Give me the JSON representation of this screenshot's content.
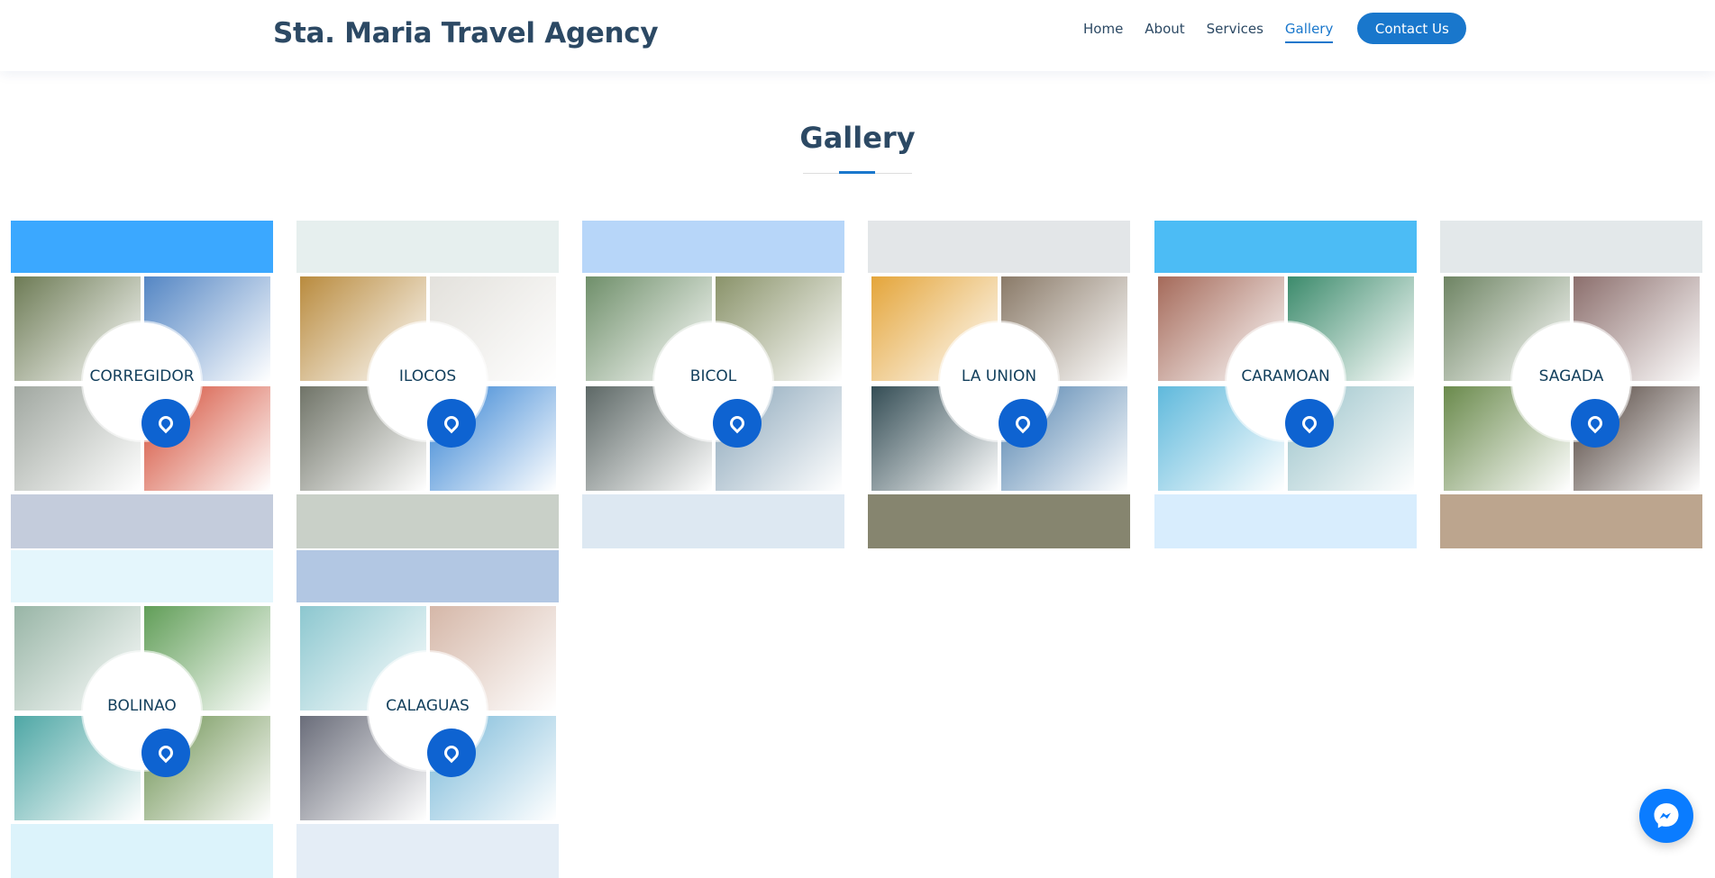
{
  "header": {
    "brand": "Sta. Maria Travel Agency",
    "nav": [
      "Home",
      "About",
      "Services",
      "Gallery"
    ],
    "active_nav": "Gallery",
    "contact_label": "Contact Us"
  },
  "section": {
    "title": "Gallery"
  },
  "gallery": [
    {
      "label": "CORREGIDOR",
      "top_color": "#3ba8ff",
      "bottom_color": "#c4ccdc",
      "quads": [
        "#6d7b55",
        "#5486c4",
        "#a0a7a0",
        "#d2462f"
      ]
    },
    {
      "label": "ILOCOS",
      "top_color": "#e6efee",
      "bottom_color": "#c9d0c8",
      "quads": [
        "#b98b3e",
        "#e3e1dc",
        "#707468",
        "#2f7fd2"
      ]
    },
    {
      "label": "BICOL",
      "top_color": "#b7d6f9",
      "bottom_color": "#dde8f2",
      "quads": [
        "#6f8f6a",
        "#8a936a",
        "#5d6866",
        "#88a4b8"
      ]
    },
    {
      "label": "LA UNION",
      "top_color": "#e3e6e8",
      "bottom_color": "#86856f",
      "quads": [
        "#e4a53a",
        "#8a7a68",
        "#344d55",
        "#4f80ad"
      ]
    },
    {
      "label": "CARAMOAN",
      "top_color": "#4cbcf5",
      "bottom_color": "#d8edfd",
      "quads": [
        "#a56a5a",
        "#3c8b6c",
        "#5fb9dc",
        "#99c2c9"
      ]
    },
    {
      "label": "SAGADA",
      "top_color": "#e3e8ea",
      "bottom_color": "#bca58e",
      "quads": [
        "#6e8463",
        "#8c6f6d",
        "#6a8a4c",
        "#4a3b34"
      ]
    },
    {
      "label": "BOLINAO",
      "top_color": "#e4f6fc",
      "bottom_color": "#dcf3fb",
      "quads": [
        "#98b5a6",
        "#619e58",
        "#4ea7a5",
        "#6a8f4e"
      ]
    },
    {
      "label": "CALAGUAS",
      "top_color": "#b2c7e3",
      "bottom_color": "#e4edf6",
      "quads": [
        "#8cc7cf",
        "#d5b7a8",
        "#6a6d7a",
        "#78b8d8"
      ]
    }
  ],
  "colors": {
    "accent": "#1977cc",
    "heading": "#2c4964",
    "messenger": "#0a7cff"
  },
  "icons": {
    "pin": "map-pin-icon",
    "messenger": "messenger-icon"
  }
}
